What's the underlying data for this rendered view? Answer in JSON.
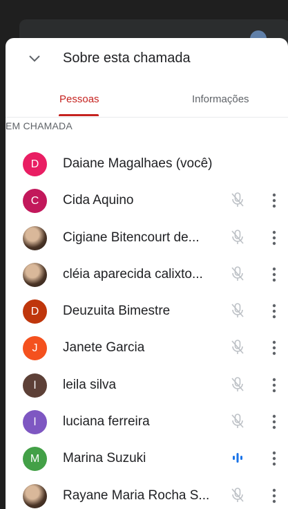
{
  "header": {
    "title": "Sobre esta chamada"
  },
  "tabs": [
    {
      "label": "Pessoas",
      "active": true
    },
    {
      "label": "Informações",
      "active": false
    }
  ],
  "section_label": "EM CHAMADA",
  "colors": {
    "accent": "#c5221f",
    "speaking": "#1a73e8",
    "muted_icon": "#bdc1c6"
  },
  "participants": [
    {
      "name": "Daiane Magalhaes (você)",
      "initial": "D",
      "avatar_color": "#e91e63",
      "avatar_type": "initial",
      "mic": "none"
    },
    {
      "name": "Cida Aquino",
      "initial": "C",
      "avatar_color": "#c2185b",
      "avatar_type": "initial",
      "mic": "muted"
    },
    {
      "name": "Cigiane Bitencourt de...",
      "initial": "",
      "avatar_color": "",
      "avatar_type": "photo",
      "mic": "muted"
    },
    {
      "name": "cléia aparecida calixto...",
      "initial": "",
      "avatar_color": "",
      "avatar_type": "photo",
      "mic": "muted"
    },
    {
      "name": "Deuzuita Bimestre",
      "initial": "D",
      "avatar_color": "#bf360c",
      "avatar_type": "initial",
      "mic": "muted"
    },
    {
      "name": "Janete Garcia",
      "initial": "J",
      "avatar_color": "#f4511e",
      "avatar_type": "initial",
      "mic": "muted"
    },
    {
      "name": "leila silva",
      "initial": "l",
      "avatar_color": "#5d4037",
      "avatar_type": "initial",
      "mic": "muted"
    },
    {
      "name": "luciana ferreira",
      "initial": "l",
      "avatar_color": "#7e57c2",
      "avatar_type": "initial",
      "mic": "muted"
    },
    {
      "name": "Marina Suzuki",
      "initial": "M",
      "avatar_color": "#43a047",
      "avatar_type": "initial",
      "mic": "speaking"
    },
    {
      "name": "Rayane Maria Rocha S...",
      "initial": "",
      "avatar_color": "",
      "avatar_type": "photo",
      "mic": "muted"
    }
  ]
}
